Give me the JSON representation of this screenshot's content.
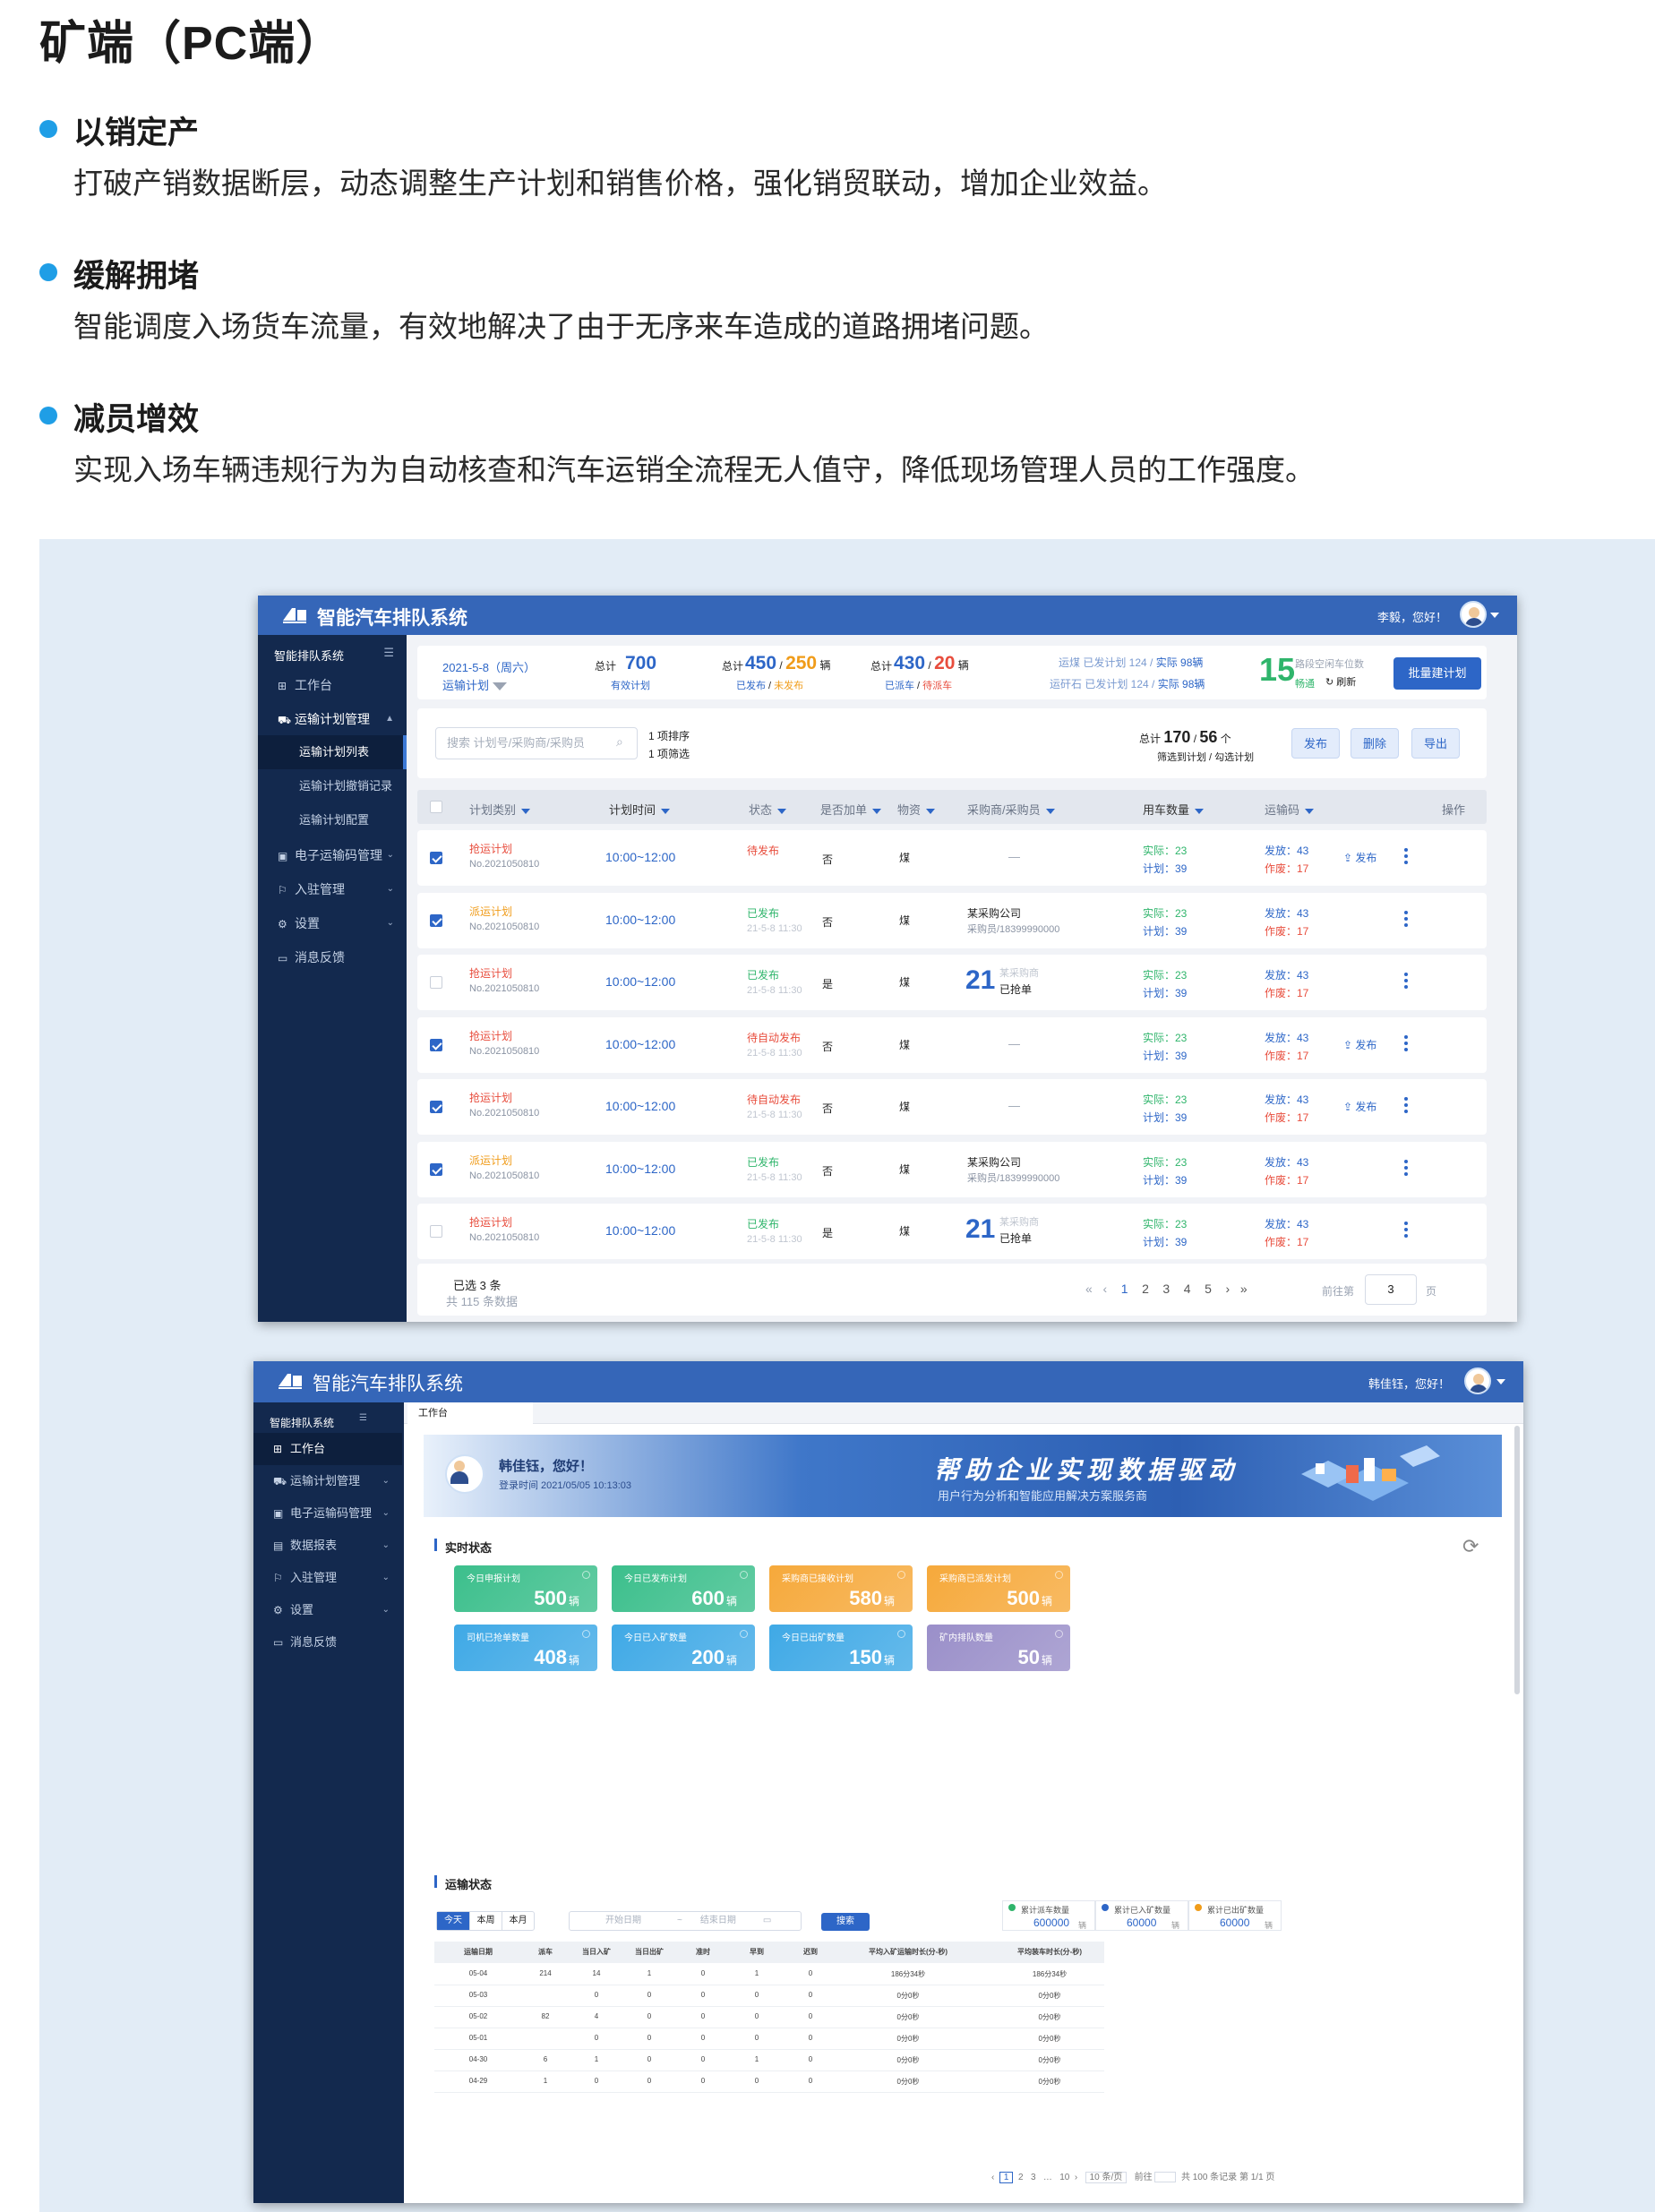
{
  "page": {
    "title": "矿端（PC端）"
  },
  "features": [
    {
      "title": "以销定产",
      "desc": "打破产销数据断层，动态调整生产计划和销售价格，强化销贸联动，增加企业效益。"
    },
    {
      "title": "缓解拥堵",
      "desc": "智能调度入场货车流量，有效地解决了由于无序来车造成的道路拥堵问题。"
    },
    {
      "title": "减员增效",
      "desc": "实现入场车辆违规行为为自动核查和汽车运销全流程无人值守，降低现场管理人员的工作强度。"
    }
  ],
  "colors": {
    "accent": "#3566b8",
    "sidebar": "#13294e",
    "panel": "#e2ecf6",
    "bullet": "#1f9ee6"
  },
  "s1": {
    "app_title": "智能汽车排队系统",
    "greeting": "李毅，您好！",
    "sidebar": {
      "header": "智能排队系统",
      "items": [
        "工作台",
        "运输计划管理",
        "电子运输码管理",
        "入驻管理",
        "设置",
        "消息反馈"
      ],
      "subitems": [
        "运输计划列表",
        "运输计划撤销记录",
        "运输计划配置"
      ]
    },
    "stats": {
      "date": "2021-5-8（周六）",
      "plan_label": "运输计划",
      "total_label": "总计",
      "total": "700",
      "valid_label": "有效计划",
      "issued": "450",
      "unissued": "250",
      "unit": "辆",
      "issued_label": "已发布",
      "unissued_label": "未发布",
      "dispatched": "430",
      "pending": "20",
      "dispatched_label": "已派车",
      "pending_label": "待派车",
      "coal": "运煤 已发计划 124 /",
      "stone": "运矸石 已发计划 124 /",
      "actual1": "实际 98辆",
      "actual2": "实际 98辆",
      "free": "15",
      "free_label": "路段空闲车位数",
      "smooth": "畅通",
      "refresh": "刷新",
      "batch_btn": "批量建计划"
    },
    "toolbar": {
      "search_placeholder": "搜索 计划号/采购商/采购员",
      "sort": "1 项排序",
      "filter": "1 项筛选",
      "total_label": "总计",
      "selected_total": "170",
      "checked": "56",
      "count_unit": "个",
      "sub": "筛选到计划 / 勾选计划",
      "publish": "发布",
      "delete": "删除",
      "export": "导出"
    },
    "columns": [
      "计划类别",
      "计划时间",
      "状态",
      "是否加单",
      "物资",
      "采购商/采购员",
      "用车数量",
      "运输码",
      "操作"
    ],
    "rows": [
      {
        "cat": "抢运计划",
        "catc": "red",
        "no": "No.2021050810",
        "time": "10:00~12:00",
        "status": "待发布",
        "sc": "red",
        "st": "",
        "add": "否",
        "mat": "煤",
        "buyer": "—",
        "bsub": "",
        "big": "",
        "actual": "实际：23",
        "plan": "计划：39",
        "sent": "发放：43",
        "void": "作废：17",
        "op": "发布",
        "checked": true
      },
      {
        "cat": "派运计划",
        "catc": "orange",
        "no": "No.2021050810",
        "time": "10:00~12:00",
        "status": "已发布",
        "sc": "green",
        "st": "21-5-8 11:30",
        "add": "否",
        "mat": "煤",
        "buyer": "某采购公司",
        "bsub": "采购员/18399990000",
        "big": "",
        "actual": "实际：23",
        "plan": "计划：39",
        "sent": "发放：43",
        "void": "作废：17",
        "op": "",
        "checked": true
      },
      {
        "cat": "抢运计划",
        "catc": "red",
        "no": "No.2021050810",
        "time": "10:00~12:00",
        "status": "已发布",
        "sc": "green",
        "st": "21-5-8 11:30",
        "add": "是",
        "mat": "煤",
        "buyer": "已抢单",
        "bsub": "某采购商",
        "big": "21",
        "actual": "实际：23",
        "plan": "计划：39",
        "sent": "发放：43",
        "void": "作废：17",
        "op": "",
        "checked": false
      },
      {
        "cat": "抢运计划",
        "catc": "red",
        "no": "No.2021050810",
        "time": "10:00~12:00",
        "status": "待自动发布",
        "sc": "red",
        "st": "21-5-8 11:30",
        "add": "否",
        "mat": "煤",
        "buyer": "—",
        "bsub": "",
        "big": "",
        "actual": "实际：23",
        "plan": "计划：39",
        "sent": "发放：43",
        "void": "作废：17",
        "op": "发布",
        "checked": true
      },
      {
        "cat": "抢运计划",
        "catc": "red",
        "no": "No.2021050810",
        "time": "10:00~12:00",
        "status": "待自动发布",
        "sc": "red",
        "st": "21-5-8 11:30",
        "add": "否",
        "mat": "煤",
        "buyer": "—",
        "bsub": "",
        "big": "",
        "actual": "实际：23",
        "plan": "计划：39",
        "sent": "发放：43",
        "void": "作废：17",
        "op": "发布",
        "checked": true
      },
      {
        "cat": "派运计划",
        "catc": "orange",
        "no": "No.2021050810",
        "time": "10:00~12:00",
        "status": "已发布",
        "sc": "green",
        "st": "21-5-8 11:30",
        "add": "否",
        "mat": "煤",
        "buyer": "某采购公司",
        "bsub": "采购员/18399990000",
        "big": "",
        "actual": "实际：23",
        "plan": "计划：39",
        "sent": "发放：43",
        "void": "作废：17",
        "op": "",
        "checked": true
      },
      {
        "cat": "抢运计划",
        "catc": "red",
        "no": "No.2021050810",
        "time": "10:00~12:00",
        "status": "已发布",
        "sc": "green",
        "st": "21-5-8 11:30",
        "add": "是",
        "mat": "煤",
        "buyer": "已抢单",
        "bsub": "某采购商",
        "big": "21",
        "actual": "实际：23",
        "plan": "计划：39",
        "sent": "发放：43",
        "void": "作废：17",
        "op": "",
        "checked": false
      }
    ],
    "footer": {
      "selected": "已选 3 条",
      "total": "共 115 条数据",
      "pages": [
        "1",
        "2",
        "3",
        "4",
        "5"
      ],
      "goto": "前往第",
      "page": "3",
      "page_unit": "页"
    }
  },
  "s2": {
    "app_title": "智能汽车排队系统",
    "greeting": "韩佳钰，您好！",
    "tab": "工作台",
    "sidebar": {
      "header": "智能排队系统",
      "items": [
        "工作台",
        "运输计划管理",
        "电子运输码管理",
        "数据报表",
        "入驻管理",
        "设置",
        "消息反馈"
      ]
    },
    "banner": {
      "hello": "韩佳钰，您好！",
      "login": "登录时间 2021/05/05 10:13:03",
      "slogan": "帮助企业实现数据驱动",
      "sub": "用户行为分析和智能应用解决方案服务商"
    },
    "realtime": {
      "title": "实时状态",
      "tiles": [
        {
          "label": "今日申报计划",
          "value": "500",
          "unit": "辆",
          "color": "#3cbf8c"
        },
        {
          "label": "今日已发布计划",
          "value": "600",
          "unit": "辆",
          "color": "#3cbf8c"
        },
        {
          "label": "采购商已接收计划",
          "value": "580",
          "unit": "辆",
          "color": "#f6a93b"
        },
        {
          "label": "采购商已派发计划",
          "value": "500",
          "unit": "辆",
          "color": "#f6a93b"
        },
        {
          "label": "司机已抢单数量",
          "value": "408",
          "unit": "辆",
          "color": "#3fa9e6"
        },
        {
          "label": "今日已入矿数量",
          "value": "200",
          "unit": "辆",
          "color": "#3fa9e6"
        },
        {
          "label": "今日已出矿数量",
          "value": "150",
          "unit": "辆",
          "color": "#3fa9e6"
        },
        {
          "label": "矿内排队数量",
          "value": "50",
          "unit": "辆",
          "color": "#9a8fc9"
        }
      ]
    },
    "transport": {
      "title": "运输状态",
      "tabs": [
        "今天",
        "本周",
        "本月"
      ],
      "start": "开始日期",
      "sep": "~",
      "end": "结束日期",
      "query": "搜索",
      "summary": [
        {
          "label": "累计派车数量",
          "value": "600000",
          "unit": "辆"
        },
        {
          "label": "累计已入矿数量",
          "value": "60000",
          "unit": "辆"
        },
        {
          "label": "累计已出矿数量",
          "value": "60000",
          "unit": "辆"
        }
      ],
      "columns": [
        "运输日期",
        "派车",
        "当日入矿",
        "当日出矿",
        "准时",
        "早到",
        "迟到",
        "平均入矿运输时长(分-秒)",
        "平均装车时长(分-秒)"
      ],
      "rows": [
        [
          "05-04",
          "214",
          "14",
          "1",
          "0",
          "1",
          "0",
          "186分34秒",
          "186分34秒"
        ],
        [
          "05-03",
          "",
          "0",
          "0",
          "0",
          "0",
          "0",
          "0分0秒",
          "0分0秒"
        ],
        [
          "05-02",
          "82",
          "4",
          "0",
          "0",
          "0",
          "0",
          "0分0秒",
          "0分0秒"
        ],
        [
          "05-01",
          "",
          "0",
          "0",
          "0",
          "0",
          "0",
          "0分0秒",
          "0分0秒"
        ],
        [
          "04-30",
          "6",
          "1",
          "0",
          "0",
          "1",
          "0",
          "0分0秒",
          "0分0秒"
        ],
        [
          "04-29",
          "1",
          "0",
          "0",
          "0",
          "0",
          "0",
          "0分0秒",
          "0分0秒"
        ]
      ],
      "pager": {
        "pages": [
          "1",
          "2",
          "3",
          "…",
          "10"
        ],
        "size": "10 条/页",
        "goto": "前往",
        "info": "共 100 条记录 第 1/1 页"
      }
    }
  }
}
